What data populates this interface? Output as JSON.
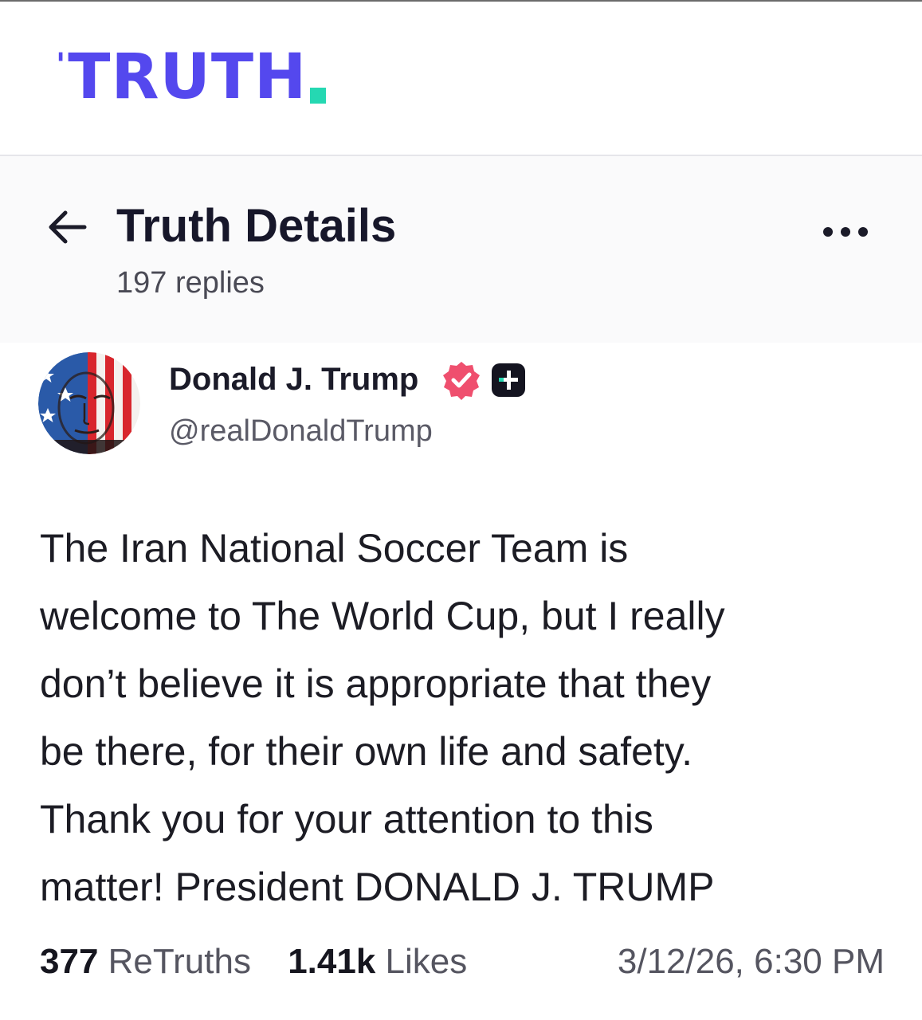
{
  "brand": {
    "name": "TRUTH",
    "color": "#5448ee",
    "dot_color": "#25d8b2"
  },
  "header": {
    "back_icon": "arrow-left-icon",
    "title": "Truth Details",
    "replies": "197 replies",
    "more_icon": "ellipsis-icon"
  },
  "post": {
    "author": {
      "name": "Donald J. Trump",
      "handle": "@realDonaldTrump",
      "verified_icon": "verified-badge-icon",
      "verified_color": "#ef4f6e",
      "plus_icon": "truth-plus-icon"
    },
    "body_lines": [
      "The Iran National Soccer Team is",
      "welcome to The World Cup, but I really",
      "don’t believe it is appropriate that they",
      "be there, for their own life and safety.",
      "Thank you for your attention to this",
      "matter! President DONALD J. TRUMP"
    ],
    "stats": {
      "retruths_count": "377",
      "retruths_label": "ReTruths",
      "likes_count": "1.41k",
      "likes_label": "Likes",
      "timestamp": "3/12/26, 6:30 PM"
    }
  }
}
